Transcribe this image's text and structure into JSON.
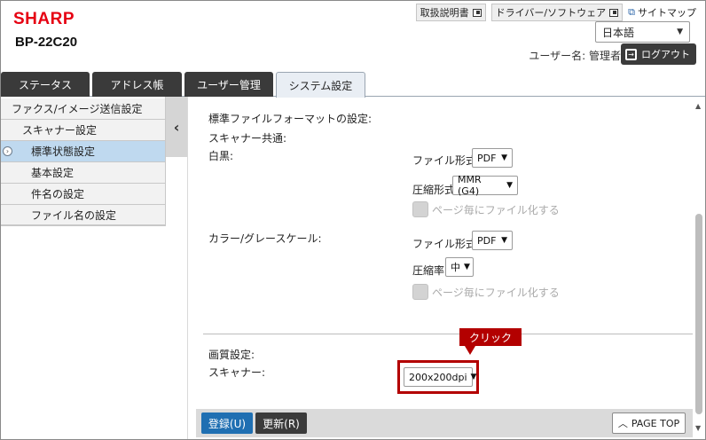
{
  "header": {
    "logo": "SHARP",
    "model": "BP-22C20",
    "links": {
      "manual": "取扱説明書",
      "driver": "ドライバー/ソフトウェア",
      "sitemap": "サイトマップ"
    },
    "language": "日本語",
    "username": "ユーザー名: 管理者",
    "logout": "ログアウト"
  },
  "tabs": [
    {
      "label": "ステータス"
    },
    {
      "label": "アドレス帳"
    },
    {
      "label": "ユーザー管理"
    },
    {
      "label": "システム設定",
      "active": true
    }
  ],
  "sidebar": {
    "items": [
      {
        "label": "ファクス/イメージ送信設定"
      },
      {
        "label": "スキャナー設定"
      },
      {
        "label": "標準状態設定",
        "selected": true
      },
      {
        "label": "基本設定"
      },
      {
        "label": "件名の設定"
      },
      {
        "label": "ファイル名の設定"
      }
    ]
  },
  "main": {
    "format_heading": "標準ファイルフォーマットの設定:",
    "scanner_common": "スキャナー共通:",
    "bw": {
      "label": "白黒:",
      "file_format_label": "ファイル形式:",
      "file_format": "PDF",
      "compression_label": "圧縮形式:",
      "compression": "MMR (G4)",
      "per_page_label": "ページ毎にファイル化する"
    },
    "color": {
      "label": "カラー/グレースケール:",
      "file_format_label": "ファイル形式:",
      "file_format": "PDF",
      "ratio_label": "圧縮率:",
      "ratio": "中",
      "per_page_label": "ページ毎にファイル化する"
    },
    "quality_heading": "画質設定:",
    "scanner_label": "スキャナー:",
    "scanner_resolution": "200x200dpi",
    "callout": "クリック"
  },
  "footer": {
    "register": "登録(U)",
    "update": "更新(R)",
    "page_top": "PAGE TOP"
  },
  "colors": {
    "brand": "#e60012",
    "callout": "#b30000",
    "primary": "#1f6fb2",
    "tab_dark": "#3a3a3a"
  }
}
